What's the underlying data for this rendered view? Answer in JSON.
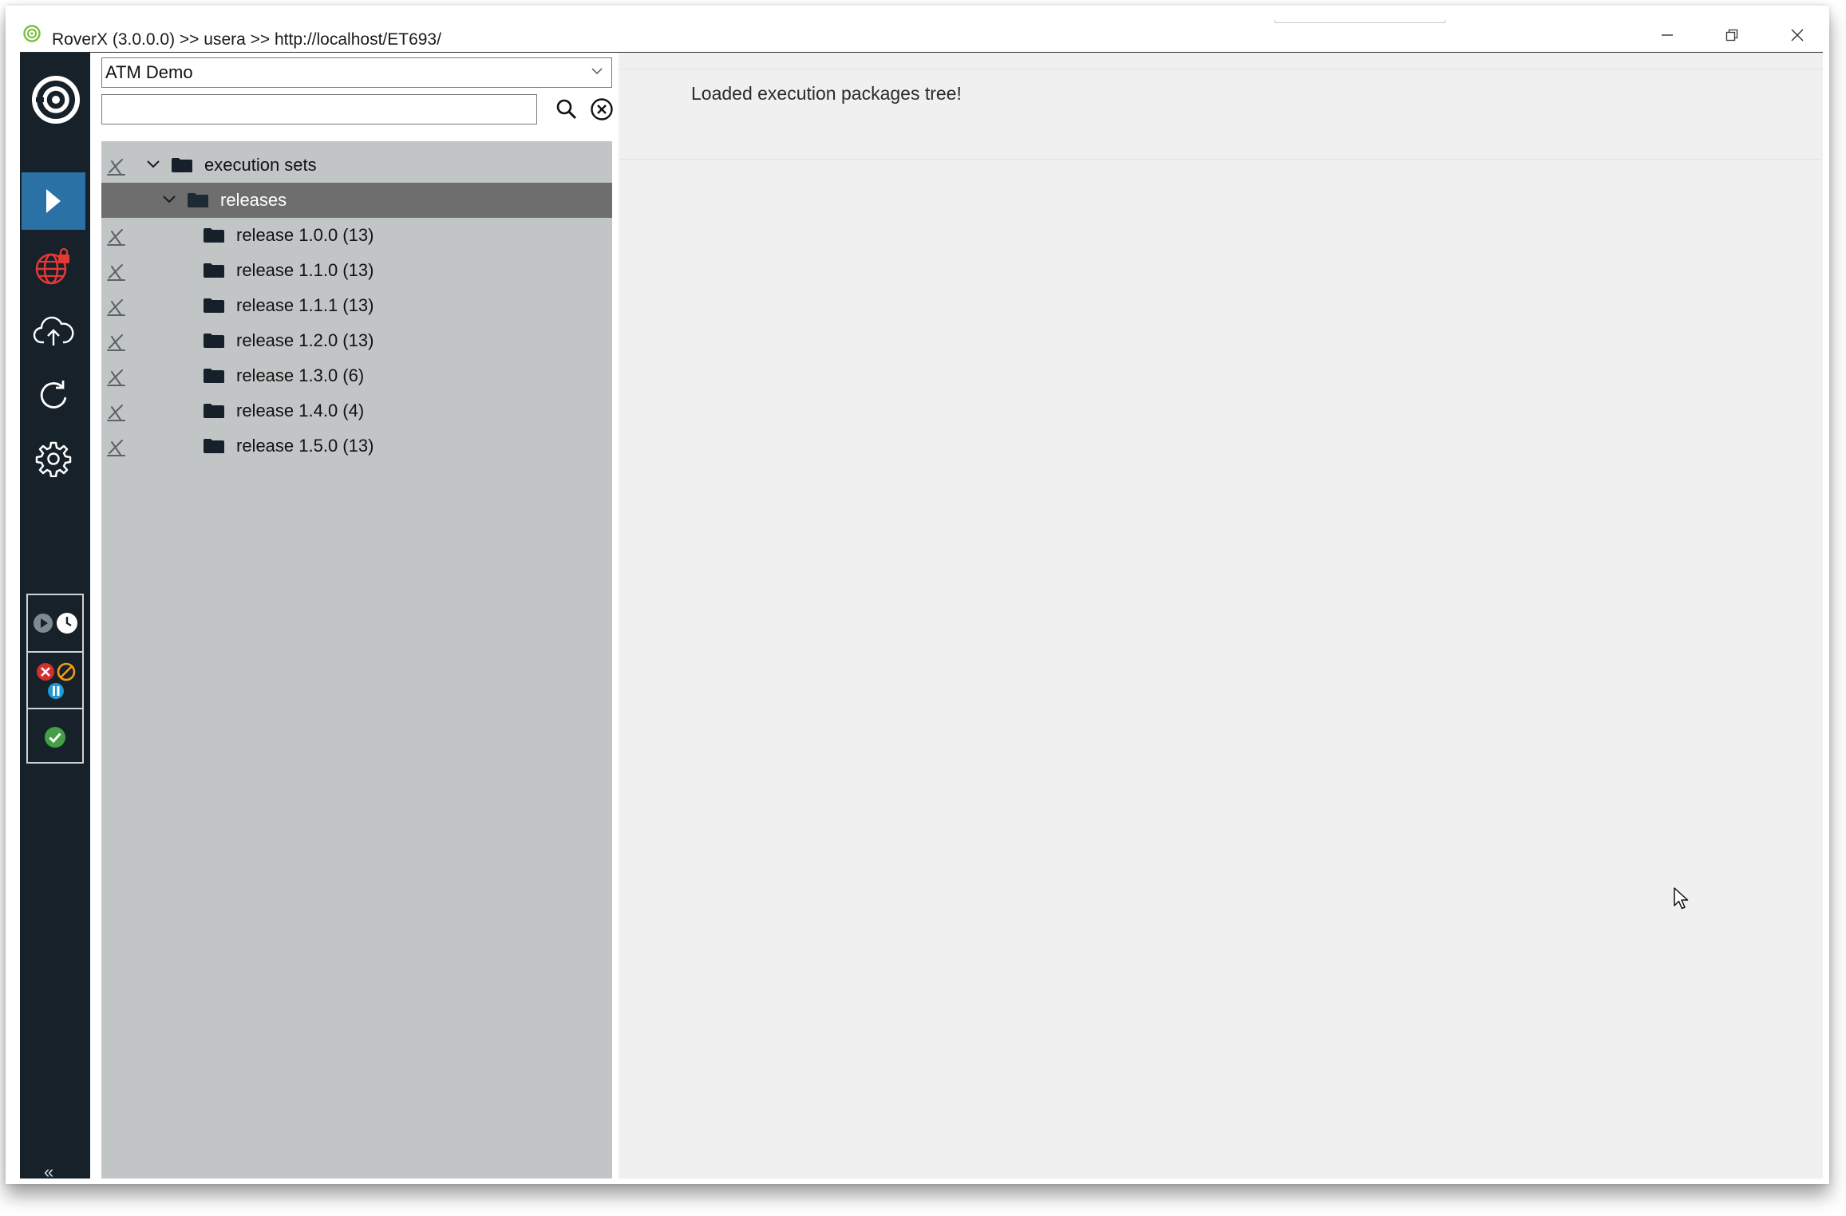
{
  "window": {
    "title": "RoverX (3.0.0.0) >> usera >> http://localhost/ET693/",
    "controls": [
      "minimize",
      "restore",
      "close"
    ]
  },
  "nav": {
    "items": [
      {
        "name": "execute",
        "icon": "play-icon",
        "active": true
      },
      {
        "name": "web-security",
        "icon": "globe-lock-icon",
        "active": false
      },
      {
        "name": "upload",
        "icon": "cloud-upload-icon",
        "active": false
      },
      {
        "name": "refresh",
        "icon": "refresh-icon",
        "active": false
      },
      {
        "name": "settings",
        "icon": "gear-icon",
        "active": false
      }
    ],
    "status_filters": [
      {
        "name": "queued-running",
        "icons": [
          "play-circle-icon",
          "clock-icon"
        ]
      },
      {
        "name": "failed-blocked-paused",
        "icons": [
          "error-icon",
          "blocked-icon",
          "pause-icon"
        ]
      },
      {
        "name": "passed",
        "icons": [
          "check-icon"
        ]
      }
    ],
    "collapse_label": "«"
  },
  "tree_panel": {
    "project": "ATM Demo",
    "search": {
      "value": "",
      "placeholder": ""
    },
    "rows": [
      {
        "label": "execution sets",
        "level": 0,
        "expanded": true,
        "selected": false
      },
      {
        "label": "releases",
        "level": 1,
        "expanded": true,
        "selected": true
      },
      {
        "label": "release 1.0.0 (13)",
        "level": 2,
        "selected": false
      },
      {
        "label": "release 1.1.0 (13)",
        "level": 2,
        "selected": false
      },
      {
        "label": "release 1.1.1 (13)",
        "level": 2,
        "selected": false
      },
      {
        "label": "release 1.2.0 (13)",
        "level": 2,
        "selected": false
      },
      {
        "label": "release 1.3.0 (6)",
        "level": 2,
        "selected": false
      },
      {
        "label": "release 1.4.0 (4)",
        "level": 2,
        "selected": false
      },
      {
        "label": "release 1.5.0 (13)",
        "level": 2,
        "selected": false
      }
    ]
  },
  "content": {
    "message": "Loaded execution packages tree!"
  },
  "colors": {
    "nav_background": "#16212a",
    "nav_active": "#2a72a5",
    "tree_background": "#c2c5c6",
    "tree_selected": "#6e6e6e",
    "content_background": "#f0f0f0"
  }
}
